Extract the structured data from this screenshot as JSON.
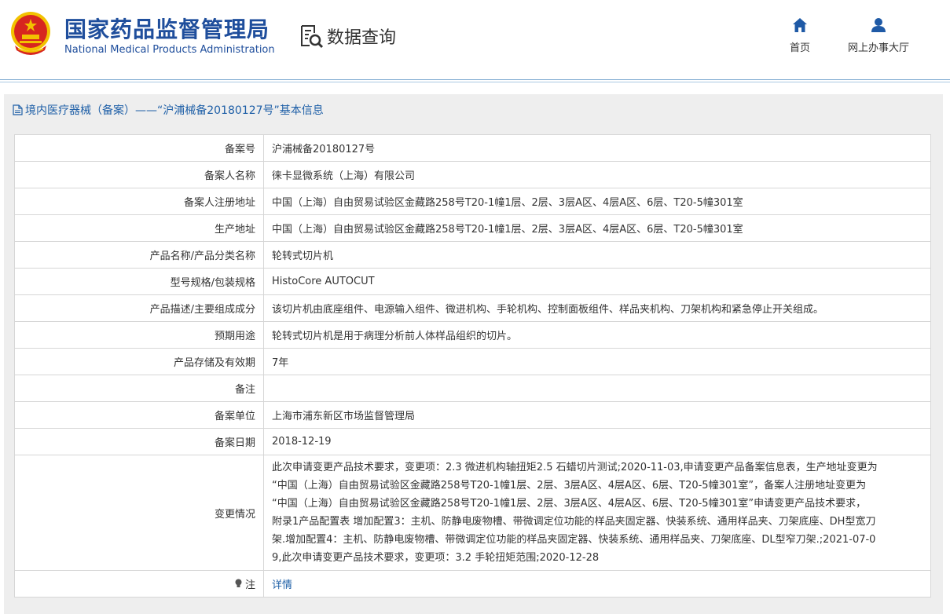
{
  "header": {
    "title_cn": "国家药品监督管理局",
    "title_en": "National Medical Products Administration",
    "search_label": "数据查询",
    "nav": {
      "home": "首页",
      "hall": "网上办事大厅"
    }
  },
  "panel": {
    "title": "境内医疗器械（备案）——“沪浦械备20180127号”基本信息"
  },
  "rows": [
    {
      "label": "备案号",
      "value": "沪浦械备20180127号"
    },
    {
      "label": "备案人名称",
      "value": "徕卡显微系统（上海）有限公司"
    },
    {
      "label": "备案人注册地址",
      "value": "中国（上海）自由贸易试验区金藏路258号T20-1幢1层、2层、3层A区、4层A区、6层、T20-5幢301室"
    },
    {
      "label": "生产地址",
      "value": "中国（上海）自由贸易试验区金藏路258号T20-1幢1层、2层、3层A区、4层A区、6层、T20-5幢301室"
    },
    {
      "label": "产品名称/产品分类名称",
      "value": "轮转式切片机"
    },
    {
      "label": "型号规格/包装规格",
      "value": "HistoCore AUTOCUT"
    },
    {
      "label": "产品描述/主要组成成分",
      "value": "该切片机由底座组件、电源输入组件、微进机构、手轮机构、控制面板组件、样品夹机构、刀架机构和紧急停止开关组成。"
    },
    {
      "label": "预期用途",
      "value": "轮转式切片机是用于病理分析前人体样品组织的切片。"
    },
    {
      "label": "产品存储及有效期",
      "value": "7年"
    },
    {
      "label": "备注",
      "value": ""
    },
    {
      "label": "备案单位",
      "value": "上海市浦东新区市场监督管理局"
    },
    {
      "label": "备案日期",
      "value": "2018-12-19"
    }
  ],
  "change": {
    "label": "变更情况",
    "lines": [
      "此次申请变更产品技术要求，变更项：2.3 微进机构轴扭矩2.5 石蜡切片测试;2020-11-03,申请变更产品备案信息表，生产地址变更为",
      "“中国（上海）自由贸易试验区金藏路258号T20-1幢1层、2层、3层A区、4层A区、6层、T20-5幢301室”，备案人注册地址变更为",
      "“中国（上海）自由贸易试验区金藏路258号T20-1幢1层、2层、3层A区、4层A区、6层、T20-5幢301室”申请变更产品技术要求，",
      "附录1产品配置表 增加配置3：主机、防静电废物槽、带微调定位功能的样品夹固定器、快装系统、通用样品夹、刀架底座、DH型宽刀",
      "架.增加配置4：主机、防静电废物槽、带微调定位功能的样品夹固定器、快装系统、通用样品夹、刀架底座、DL型窄刀架.;2021-07-0",
      "9,此次申请变更产品技术要求，变更项：3.2 手轮扭矩范围;2020-12-28"
    ]
  },
  "note": {
    "label": "注",
    "link": "详情"
  },
  "colors": {
    "brand_blue": "#1f4e9c",
    "link_blue": "#1e5fa7",
    "emblem_red": "#d7261f",
    "emblem_gold": "#f2c200"
  }
}
